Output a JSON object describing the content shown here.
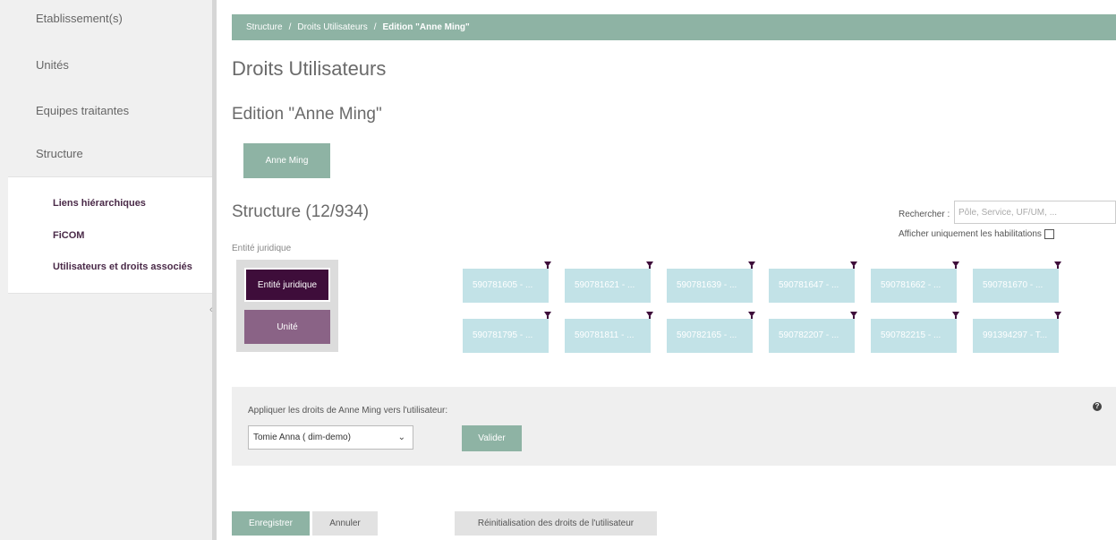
{
  "sidebar": {
    "items": [
      {
        "label": "Etablissement(s)"
      },
      {
        "label": "Unités"
      },
      {
        "label": "Equipes traitantes"
      },
      {
        "label": "Structure"
      }
    ],
    "subitems": [
      {
        "label": "Liens hiérarchiques"
      },
      {
        "label": "FiCOM"
      },
      {
        "label": "Utilisateurs et droits associés"
      }
    ],
    "collapse_glyph": "‹"
  },
  "breadcrumb": {
    "items": [
      "Structure",
      "Droits Utilisateurs"
    ],
    "current": "Edition \"Anne Ming\"",
    "separator": "/"
  },
  "page_title": "Droits Utilisateurs",
  "edit_title": "Edition \"Anne Ming\"",
  "user_button": "Anne Ming",
  "structure": {
    "title": "Structure (12/934)",
    "level_label": "Entité juridique",
    "types": [
      "Entité juridique",
      "Unité"
    ],
    "search_label": "Rechercher :",
    "search_placeholder": "Pôle, Service, UF/UM, ...",
    "filter_label": "Afficher uniquement les habilitations",
    "tiles": [
      "590781605 - ...",
      "590781621 - ...",
      "590781639 - ...",
      "590781647 - ...",
      "590781662 - ...",
      "590781670 - ...",
      "590781795 - ...",
      "590781811 - ...",
      "590782165 - ...",
      "590782207 - ...",
      "590782215 - ...",
      "991394297 - T..."
    ]
  },
  "apply": {
    "label": "Appliquer les droits de Anne Ming vers l'utilisateur:",
    "selected_user": "Tomie Anna ( dim-demo)",
    "validate": "Valider",
    "help_glyph": "?"
  },
  "actions": {
    "save": "Enregistrer",
    "cancel": "Annuler",
    "reset": "Réinitialisation des droits de l'utilisateur"
  },
  "colors": {
    "accent": "#8eb3a4",
    "active_type": "#3e0d3a",
    "inactive_type": "#8a6386",
    "tile": "#c2e2e7"
  }
}
